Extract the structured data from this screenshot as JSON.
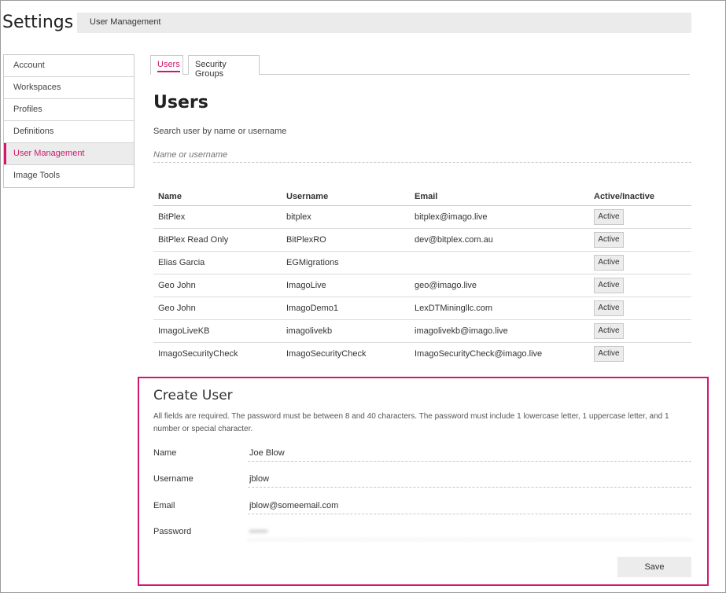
{
  "header": {
    "title": "Settings",
    "breadcrumb": "User Management"
  },
  "sidebar": {
    "items": [
      {
        "label": "Account"
      },
      {
        "label": "Workspaces"
      },
      {
        "label": "Profiles"
      },
      {
        "label": "Definitions"
      },
      {
        "label": "User Management",
        "active": true
      },
      {
        "label": "Image Tools"
      }
    ]
  },
  "tabs": [
    {
      "label": "Users",
      "active": true
    },
    {
      "label": "Security Groups"
    }
  ],
  "main": {
    "title": "Users",
    "search": {
      "label": "Search user by name or username",
      "placeholder": "Name or username",
      "value": ""
    }
  },
  "table": {
    "columns": [
      "Name",
      "Username",
      "Email",
      "Active/Inactive"
    ],
    "rows": [
      {
        "name": "BitPlex",
        "username": "bitplex",
        "email": "bitplex@imago.live",
        "status": "Active"
      },
      {
        "name": "BitPlex Read Only",
        "username": "BitPlexRO",
        "email": "dev@bitplex.com.au",
        "status": "Active"
      },
      {
        "name": "Elias Garcia",
        "username": "EGMigrations",
        "email": "",
        "status": "Active"
      },
      {
        "name": "Geo John",
        "username": "ImagoLive",
        "email": "geo@imago.live",
        "status": "Active"
      },
      {
        "name": "Geo John",
        "username": "ImagoDemo1",
        "email": "LexDTMiningllc.com",
        "status": "Active"
      },
      {
        "name": "ImagoLiveKB",
        "username": "imagolivekb",
        "email": "imagolivekb@imago.live",
        "status": "Active"
      },
      {
        "name": "ImagoSecurityCheck",
        "username": "ImagoSecurityCheck",
        "email": "ImagoSecurityCheck@imago.live",
        "status": "Active"
      }
    ]
  },
  "create_user": {
    "title": "Create User",
    "description": "All fields are required. The password must be between 8 and 40 characters. The password must include 1 lowercase letter, 1 uppercase letter, and 1 number or special character.",
    "fields": [
      {
        "label": "Name",
        "value": "Joe Blow"
      },
      {
        "label": "Username",
        "value": "jblow"
      },
      {
        "label": "Email",
        "value": "jblow@someemail.com"
      },
      {
        "label": "Password",
        "value": "••••••"
      }
    ],
    "save_label": "Save"
  },
  "colors": {
    "accent": "#d0186e",
    "breadcrumb_bg": "#ebebeb",
    "button_bg": "#ececec"
  }
}
